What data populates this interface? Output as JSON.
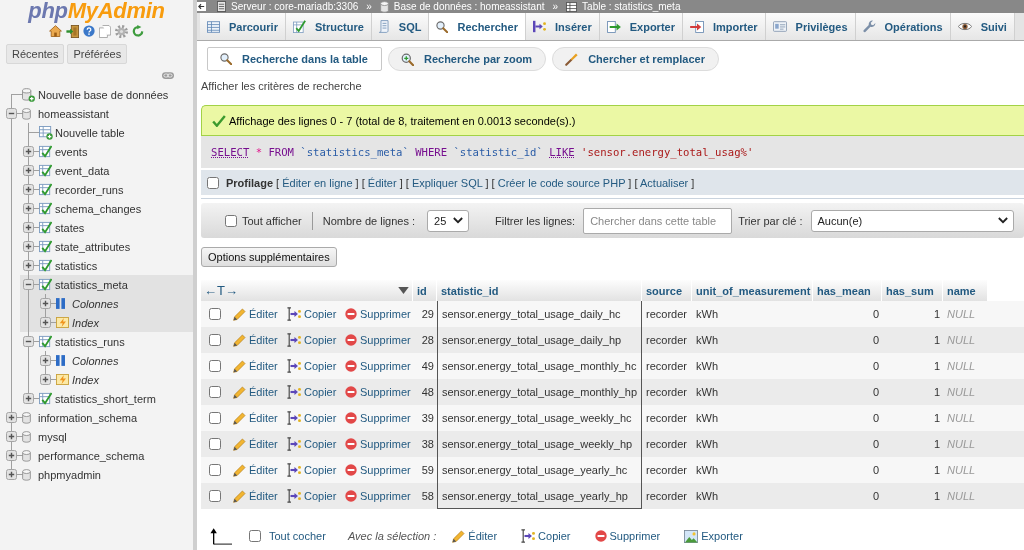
{
  "sidebar": {
    "logo": [
      "php",
      "MyAdmin"
    ],
    "buttons": [
      "Récentes",
      "Préférées"
    ],
    "tree": [
      {
        "label": "Nouvelle base de données",
        "kind": "new_database",
        "selected": false
      },
      {
        "label": "homeassistant",
        "kind": "database",
        "expanded": true,
        "selected": false,
        "children": [
          {
            "label": "Nouvelle table",
            "kind": "new_table",
            "selected": false
          },
          {
            "label": "events",
            "kind": "table",
            "expanded": false,
            "selected": false
          },
          {
            "label": "event_data",
            "kind": "table",
            "expanded": false,
            "selected": false
          },
          {
            "label": "recorder_runs",
            "kind": "table",
            "expanded": false,
            "selected": false
          },
          {
            "label": "schema_changes",
            "kind": "table",
            "expanded": false,
            "selected": false
          },
          {
            "label": "states",
            "kind": "table",
            "expanded": false,
            "selected": false
          },
          {
            "label": "state_attributes",
            "kind": "table",
            "expanded": false,
            "selected": false
          },
          {
            "label": "statistics",
            "kind": "table",
            "expanded": false,
            "selected": false
          },
          {
            "label": "statistics_meta",
            "kind": "table",
            "expanded": true,
            "selected": true,
            "children": [
              {
                "label": "Colonnes",
                "kind": "columns",
                "expanded": false,
                "selected": false
              },
              {
                "label": "Index",
                "kind": "indexes",
                "expanded": false,
                "selected": false
              }
            ]
          },
          {
            "label": "statistics_runs",
            "kind": "table",
            "expanded": true,
            "selected": false,
            "children": [
              {
                "label": "Colonnes",
                "kind": "columns",
                "expanded": false,
                "selected": false
              },
              {
                "label": "Index",
                "kind": "indexes",
                "expanded": false,
                "selected": false
              }
            ]
          },
          {
            "label": "statistics_short_term",
            "kind": "table",
            "expanded": false,
            "selected": false
          }
        ]
      },
      {
        "label": "information_schema",
        "kind": "database",
        "expanded": false,
        "selected": false
      },
      {
        "label": "mysql",
        "kind": "database",
        "expanded": false,
        "selected": false
      },
      {
        "label": "performance_schema",
        "kind": "database",
        "expanded": false,
        "selected": false
      },
      {
        "label": "phpmyadmin",
        "kind": "database",
        "expanded": false,
        "selected": false
      }
    ]
  },
  "breadcrumb": {
    "items": [
      "Serveur : core-mariadb:3306",
      "Base de données : homeassistant",
      "Table : statistics_meta"
    ],
    "separator": "»"
  },
  "tabs": [
    {
      "label": "Parcourir",
      "selected": false
    },
    {
      "label": "Structure",
      "selected": false
    },
    {
      "label": "SQL",
      "selected": false
    },
    {
      "label": "Rechercher",
      "selected": true
    },
    {
      "label": "Insérer",
      "selected": false
    },
    {
      "label": "Exporter",
      "selected": false
    },
    {
      "label": "Importer",
      "selected": false
    },
    {
      "label": "Privilèges",
      "selected": false
    },
    {
      "label": "Opérations",
      "selected": false
    },
    {
      "label": "Suivi",
      "selected": false
    }
  ],
  "subtabs": [
    {
      "label": "Recherche dans la table",
      "selected": true
    },
    {
      "label": "Recherche par zoom",
      "selected": false
    },
    {
      "label": "Chercher et remplacer",
      "selected": false
    }
  ],
  "criteria_toggle": "Afficher les critères de recherche",
  "message": {
    "kind": "success",
    "text": "Affichage des lignes 0 - 7 (total de 8, traitement en 0.0013 seconde(s).)"
  },
  "sql": [
    {
      "kind": "keyword_link",
      "text": "SELECT"
    },
    {
      "kind": "operator",
      "text": "*"
    },
    {
      "kind": "keyword",
      "text": "FROM"
    },
    {
      "kind": "identifier",
      "text": "`statistics_meta`"
    },
    {
      "kind": "keyword",
      "text": "WHERE"
    },
    {
      "kind": "identifier",
      "text": "`statistic_id`"
    },
    {
      "kind": "keyword_link",
      "text": "LIKE"
    },
    {
      "kind": "string",
      "text": "'sensor.energy_total_usag%'"
    }
  ],
  "profiling": {
    "label": "Profilage",
    "checked": false,
    "open": "[",
    "close": "]",
    "links": [
      "Éditer en ligne",
      "Éditer",
      "Expliquer SQL",
      "Créer le code source PHP",
      "Actualiser"
    ]
  },
  "filter_bar": {
    "show_all": {
      "label": "Tout afficher",
      "checked": false
    },
    "rows": {
      "label": "Nombre de lignes :",
      "value": "25"
    },
    "filter": {
      "label": "Filtrer les lignes:",
      "placeholder": "Chercher dans cette table"
    },
    "sort": {
      "label": "Trier par clé :",
      "value": "Aucun(e)"
    }
  },
  "options_button": "Options supplémentaires",
  "table": {
    "toggle": "←T→",
    "columns": [
      {
        "label": "id",
        "marked": false
      },
      {
        "label": "statistic_id",
        "marked": true
      },
      {
        "label": "source",
        "marked": false
      },
      {
        "label": "unit_of_measurement",
        "marked": false
      },
      {
        "label": "has_mean",
        "marked": false
      },
      {
        "label": "has_sum",
        "marked": false
      },
      {
        "label": "name",
        "marked": false
      }
    ],
    "rows": [
      {
        "selected": false,
        "actions": [
          "Éditer",
          "Copier",
          "Supprimer"
        ],
        "cells": [
          {
            "kind": "number",
            "text": "29"
          },
          {
            "kind": "text",
            "text": "sensor.energy_total_usage_daily_hc"
          },
          {
            "kind": "text",
            "text": "recorder"
          },
          {
            "kind": "text",
            "text": "kWh"
          },
          {
            "kind": "number",
            "text": "0"
          },
          {
            "kind": "number",
            "text": "1"
          },
          {
            "kind": "null",
            "text": "NULL"
          }
        ]
      },
      {
        "selected": false,
        "actions": [
          "Éditer",
          "Copier",
          "Supprimer"
        ],
        "cells": [
          {
            "kind": "number",
            "text": "28"
          },
          {
            "kind": "text",
            "text": "sensor.energy_total_usage_daily_hp"
          },
          {
            "kind": "text",
            "text": "recorder"
          },
          {
            "kind": "text",
            "text": "kWh"
          },
          {
            "kind": "number",
            "text": "0"
          },
          {
            "kind": "number",
            "text": "1"
          },
          {
            "kind": "null",
            "text": "NULL"
          }
        ]
      },
      {
        "selected": false,
        "actions": [
          "Éditer",
          "Copier",
          "Supprimer"
        ],
        "cells": [
          {
            "kind": "number",
            "text": "49"
          },
          {
            "kind": "text",
            "text": "sensor.energy_total_usage_monthly_hc"
          },
          {
            "kind": "text",
            "text": "recorder"
          },
          {
            "kind": "text",
            "text": "kWh"
          },
          {
            "kind": "number",
            "text": "0"
          },
          {
            "kind": "number",
            "text": "1"
          },
          {
            "kind": "null",
            "text": "NULL"
          }
        ]
      },
      {
        "selected": false,
        "actions": [
          "Éditer",
          "Copier",
          "Supprimer"
        ],
        "cells": [
          {
            "kind": "number",
            "text": "48"
          },
          {
            "kind": "text",
            "text": "sensor.energy_total_usage_monthly_hp"
          },
          {
            "kind": "text",
            "text": "recorder"
          },
          {
            "kind": "text",
            "text": "kWh"
          },
          {
            "kind": "number",
            "text": "0"
          },
          {
            "kind": "number",
            "text": "1"
          },
          {
            "kind": "null",
            "text": "NULL"
          }
        ]
      },
      {
        "selected": false,
        "actions": [
          "Éditer",
          "Copier",
          "Supprimer"
        ],
        "cells": [
          {
            "kind": "number",
            "text": "39"
          },
          {
            "kind": "text",
            "text": "sensor.energy_total_usage_weekly_hc"
          },
          {
            "kind": "text",
            "text": "recorder"
          },
          {
            "kind": "text",
            "text": "kWh"
          },
          {
            "kind": "number",
            "text": "0"
          },
          {
            "kind": "number",
            "text": "1"
          },
          {
            "kind": "null",
            "text": "NULL"
          }
        ]
      },
      {
        "selected": false,
        "actions": [
          "Éditer",
          "Copier",
          "Supprimer"
        ],
        "cells": [
          {
            "kind": "number",
            "text": "38"
          },
          {
            "kind": "text",
            "text": "sensor.energy_total_usage_weekly_hp"
          },
          {
            "kind": "text",
            "text": "recorder"
          },
          {
            "kind": "text",
            "text": "kWh"
          },
          {
            "kind": "number",
            "text": "0"
          },
          {
            "kind": "number",
            "text": "1"
          },
          {
            "kind": "null",
            "text": "NULL"
          }
        ]
      },
      {
        "selected": false,
        "actions": [
          "Éditer",
          "Copier",
          "Supprimer"
        ],
        "cells": [
          {
            "kind": "number",
            "text": "59"
          },
          {
            "kind": "text",
            "text": "sensor.energy_total_usage_yearly_hc"
          },
          {
            "kind": "text",
            "text": "recorder"
          },
          {
            "kind": "text",
            "text": "kWh"
          },
          {
            "kind": "number",
            "text": "0"
          },
          {
            "kind": "number",
            "text": "1"
          },
          {
            "kind": "null",
            "text": "NULL"
          }
        ]
      },
      {
        "selected": false,
        "actions": [
          "Éditer",
          "Copier",
          "Supprimer"
        ],
        "cells": [
          {
            "kind": "number",
            "text": "58"
          },
          {
            "kind": "text",
            "text": "sensor.energy_total_usage_yearly_hp"
          },
          {
            "kind": "text",
            "text": "recorder"
          },
          {
            "kind": "text",
            "text": "kWh"
          },
          {
            "kind": "number",
            "text": "0"
          },
          {
            "kind": "number",
            "text": "1"
          },
          {
            "kind": "null",
            "text": "NULL"
          }
        ]
      }
    ]
  },
  "bulk_actions": {
    "check_all": {
      "label": "Tout cocher",
      "checked": false
    },
    "label": "Avec la sélection :",
    "actions": [
      "Éditer",
      "Copier",
      "Supprimer",
      "Exporter"
    ]
  }
}
